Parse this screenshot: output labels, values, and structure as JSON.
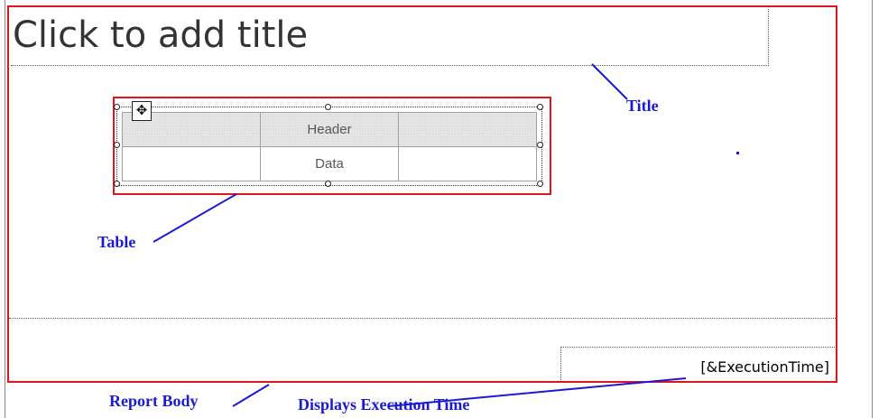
{
  "title_placeholder": "Click to add title",
  "table": {
    "header_row": [
      "",
      "Header",
      ""
    ],
    "data_row": [
      "",
      "Data",
      ""
    ]
  },
  "footer": {
    "execution_time_field": "[&ExecutionTime]"
  },
  "callouts": {
    "title": "Title",
    "table": "Table",
    "report_body": "Report Body",
    "execution_time": "Displays Execution Time"
  },
  "colors": {
    "callout": "#1a1ad6",
    "highlight": "#e0141e"
  },
  "icons": {
    "move_handle": "move-arrows-icon"
  }
}
